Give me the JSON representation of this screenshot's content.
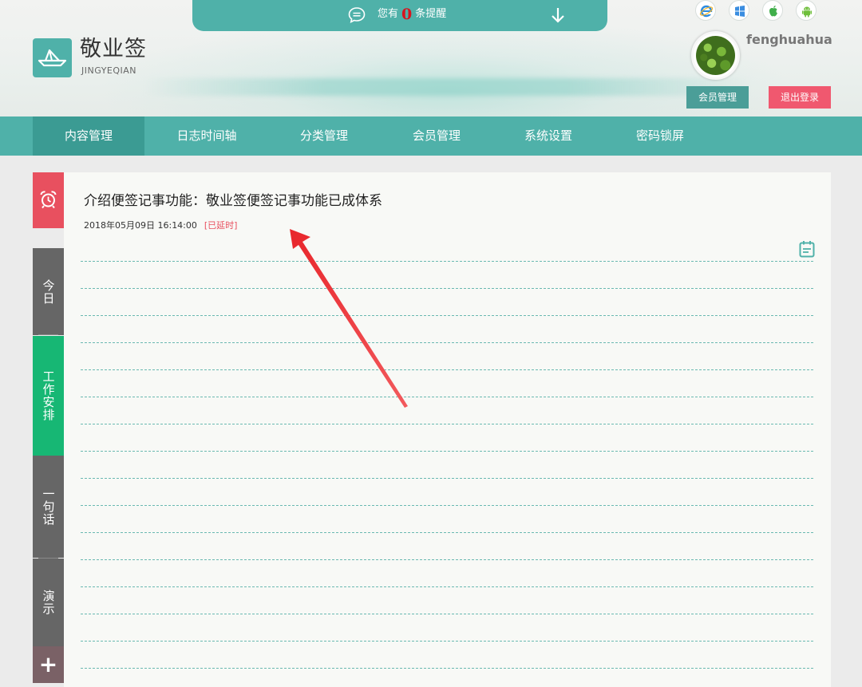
{
  "header": {
    "reminder": {
      "prefix": "您有",
      "count": "0",
      "suffix": "条提醒"
    },
    "brand": {
      "name": "敬业签",
      "sub": "JINGYEQIAN"
    },
    "platforms": [
      "ie-icon",
      "windows-icon",
      "apple-icon",
      "android-icon"
    ],
    "user": {
      "name": "fenghuahua"
    },
    "member_button": "会员管理",
    "logout_button": "退出登录"
  },
  "nav": {
    "items": [
      "内容管理",
      "日志时间轴",
      "分类管理",
      "会员管理",
      "系统设置",
      "密码锁屏"
    ],
    "active_index": 0
  },
  "sidebar": {
    "tabs": [
      "今日",
      "工作安排",
      "一句话",
      "演示"
    ],
    "active_index": 1,
    "add_label": "+"
  },
  "note": {
    "title": "介绍便签记事功能：敬业签便签记事功能已成体系",
    "datetime": "2018年05月09日 16:14:00",
    "status": "[已延时]"
  },
  "colors": {
    "accent": "#4fb1a9",
    "nav_active": "#3b9b93",
    "alarm": "#e8505f",
    "sidebar_active": "#17b774",
    "logout": "#f0586f",
    "count": "#d8141e"
  }
}
